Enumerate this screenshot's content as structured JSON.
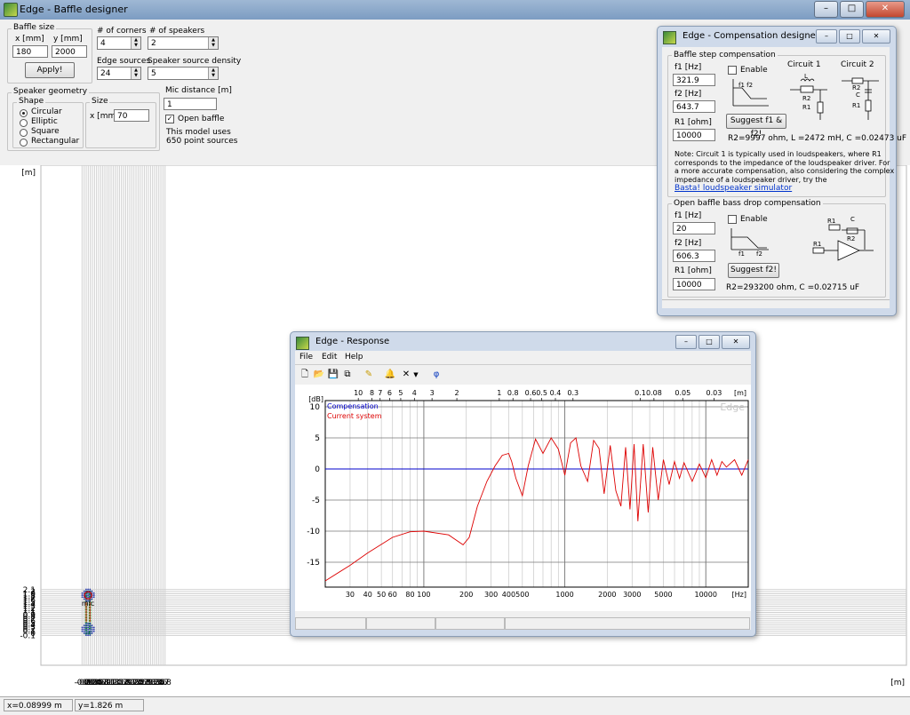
{
  "window": {
    "title": "Edge - Baffle designer",
    "min": "–",
    "max": "□",
    "close": "✕"
  },
  "baffle": {
    "group": "Baffle size",
    "x_label": "x [mm]",
    "y_label": "y [mm]",
    "x_value": "180",
    "y_value": "2000",
    "apply": "Apply!"
  },
  "corners": {
    "label": "# of corners",
    "value": "4"
  },
  "speakers": {
    "label": "# of speakers",
    "value": "2"
  },
  "edge_sources": {
    "label": "Edge sources",
    "value": "24"
  },
  "density": {
    "label": "Speaker source density",
    "value": "5"
  },
  "geometry": {
    "group": "Speaker geometry",
    "shape_group": "Shape",
    "shapes": [
      "Circular",
      "Elliptic",
      "Square",
      "Rectangular"
    ],
    "selected": 0,
    "size_group": "Size",
    "size_label": "x [mm]",
    "size_value": "70"
  },
  "mic": {
    "label": "Mic distance [m]",
    "value": "1",
    "open_baffle": "Open baffle",
    "open_checked": true,
    "info1": "This model uses",
    "info2": "650 point sources"
  },
  "main_plot": {
    "unit": "[m]",
    "y_ticks": [
      "2.1",
      "2",
      "1.9",
      "1.8",
      "1.7",
      "1.6",
      "1.5",
      "1.4",
      "1.3",
      "1.2",
      "1.1",
      "1",
      "0.9",
      "0.8",
      "0.7",
      "0.6",
      "0.5",
      "0.4",
      "0.3",
      "0.2",
      "0.1",
      "0",
      "-0.1"
    ],
    "x_ticks": [
      "-0.2",
      "-0.1",
      "0",
      "0.1",
      "0.2",
      "0.3",
      "0.4",
      "0.5",
      "0.6",
      "0.7",
      "0.8",
      "0.9",
      "1",
      "1.1",
      "1.2",
      "1.3",
      "1.4",
      "1.5",
      "1.6",
      "1.7",
      "1.8",
      "1.9",
      "2",
      "2.1",
      "2.2",
      "2.3",
      "2.4",
      "2.5",
      "2.6",
      "2.7",
      "2.8",
      "2.9",
      "3",
      "3.1",
      "3.2",
      "3.3",
      "3.4",
      "3.5",
      "3.6",
      "3.7",
      "3.8"
    ],
    "mic_label": "mic"
  },
  "status": {
    "x": "x=0.08999 m",
    "y": "y=1.826 m"
  },
  "comp": {
    "title": "Edge - Compensation designer",
    "step_group": "Baffle step compensation",
    "f1_label": "f1 [Hz]",
    "f1": "321.9",
    "f2_label": "f2 [Hz]",
    "f2": "643.7",
    "r1_label": "R1 [ohm]",
    "r1": "10000",
    "enable": "Enable",
    "suggest": "Suggest f1 & f2!",
    "result": "R2=9997 ohm, L =2472 mH, C =0.02473 uF",
    "circuit1": "Circuit 1",
    "circuit2": "Circuit 2",
    "note": [
      "Note: Circuit 1 is typically used in loudspeakers, where R1",
      "corresponds to the impedance of the loudspeaker driver. For",
      "a more accurate compensation, also considering the complex",
      "impedance of a loudspeaker driver, try the"
    ],
    "link": "Basta! loudspeaker simulator",
    "drop_group": "Open baffle bass drop compensation",
    "d_f1_label": "f1 [Hz]",
    "d_f1": "20",
    "d_f2_label": "f2 [Hz]",
    "d_f2": "606.3",
    "d_r1_label": "R1 [ohm]",
    "d_r1": "10000",
    "d_enable": "Enable",
    "d_suggest": "Suggest f2!",
    "d_result": "R2=293200 ohm, C =0.02715 uF"
  },
  "resp": {
    "title": "Edge - Response",
    "menu": [
      "File",
      "Edit",
      "Help"
    ],
    "toolbar": [
      "new-icon",
      "open-icon",
      "save-icon",
      "copy-icon",
      "pen-icon",
      "bell-icon",
      "delete-icon",
      "dropdown-icon",
      "phase-icon"
    ],
    "legend_comp": "Compensation",
    "legend_current": "Current system",
    "watermark": "Edge",
    "db_unit": "[dB]",
    "hz_unit": "[Hz]",
    "m_unit": "[m]",
    "db_ticks": [
      "10",
      "5",
      "0",
      "-5",
      "-10",
      "-15"
    ],
    "hz_ticks": [
      "30",
      "40",
      "50",
      "60",
      "80",
      "100",
      "200",
      "300",
      "400",
      "500",
      "1000",
      "2000",
      "3000",
      "5000",
      "10000"
    ],
    "m_ticks": [
      "10",
      "8",
      "7",
      "6",
      "5",
      "4",
      "3",
      "2",
      "1",
      "0.8",
      "0.6",
      "0.5",
      "0.4",
      "0.3",
      "0.1",
      "0.08",
      "0.05",
      "0.03"
    ]
  },
  "chart_data": {
    "type": "line",
    "xlabel": "[Hz]",
    "ylabel": "[dB]",
    "xscale": "log",
    "xlim": [
      20,
      20000
    ],
    "ylim": [
      -19,
      11
    ],
    "series": [
      {
        "name": "Compensation",
        "color": "#0000cc",
        "x": [
          20,
          20000
        ],
        "y": [
          0,
          0
        ]
      },
      {
        "name": "Current system",
        "color": "#dd0000",
        "x": [
          20,
          30,
          40,
          60,
          80,
          100,
          150,
          190,
          210,
          240,
          280,
          320,
          360,
          400,
          420,
          450,
          500,
          550,
          620,
          700,
          800,
          900,
          1000,
          1100,
          1200,
          1300,
          1450,
          1600,
          1750,
          1900,
          2100,
          2300,
          2500,
          2700,
          2900,
          3100,
          3300,
          3600,
          3900,
          4200,
          4600,
          5000,
          5500,
          6000,
          6500,
          7000,
          8000,
          9000,
          10000,
          11000,
          12000,
          13000,
          14000,
          16000,
          18000,
          20000
        ],
        "y": [
          -18,
          -15.5,
          -13.5,
          -11,
          -10.1,
          -10,
          -10.6,
          -12.2,
          -11,
          -6,
          -2,
          0.5,
          2.2,
          2.5,
          1.2,
          -1.5,
          -4.3,
          0.5,
          4.8,
          2.5,
          5,
          3.2,
          -1,
          4.2,
          5,
          0.5,
          -2,
          4.6,
          3.3,
          -4,
          3.8,
          -3.5,
          -6,
          3.5,
          -6.5,
          4,
          -8.4,
          4,
          -7,
          3.5,
          -5,
          1.5,
          -2.5,
          1.2,
          -1.5,
          1,
          -2,
          0.8,
          -1.4,
          1.5,
          -1,
          1.2,
          0.3,
          1.5,
          -1,
          1.5
        ]
      }
    ]
  }
}
